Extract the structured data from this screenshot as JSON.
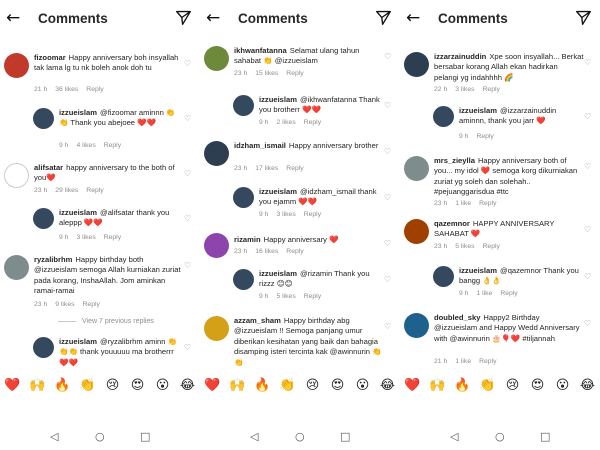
{
  "header": {
    "title": "Comments",
    "back_icon": "←"
  },
  "colors": {
    "heart": "#ed2939",
    "link": "#00376b",
    "meta": "#8e8e8e",
    "watermark": "#d38ccc"
  },
  "panels": [
    {
      "comments": [
        {
          "user": "fizoomar",
          "text": "Happy anniversary boh insyallah tak lama lg tu nk boleh anok doh tu",
          "time": "21 h",
          "likes": "36 likes",
          "reply": "Reply"
        },
        {
          "user": "izzueislam",
          "text": "@fizoomar aminnn 👏👏 Thank you abejoee ❤️❤️",
          "time": "9 h",
          "likes": "4 likes",
          "reply": "Reply"
        },
        {
          "user": "alifsatar",
          "text": "happy anniversary to the both of you❤️",
          "time": "23 h",
          "likes": "29 likes",
          "reply": "Reply"
        },
        {
          "user": "izzueislam",
          "text": "@alifsatar thank you aleppp ❤️❤️",
          "time": "9 h",
          "likes": "3 likes",
          "reply": "Reply"
        },
        {
          "user": "ryzalibrhm",
          "text": "Happy birthday both @izzueislam semoga Allah kurniakan zuriat pada korang, InshaAllah. Jom aminkan ramai-ramai",
          "time": "23 h",
          "likes": "9 likes",
          "reply": "Reply"
        },
        {
          "user": "izzueislam",
          "text": "@ryzalibrhm aminn 👏👏👏 thank youuuuu ma brotherrr ❤️❤️",
          "time": "",
          "likes": "",
          "reply": ""
        }
      ],
      "view_more": "View 7 previous replies"
    },
    {
      "comments": [
        {
          "user": "ikhwanfatanna",
          "text": "Selamat ulang tahun sahabat 👏 @izzueislam",
          "time": "23 h",
          "likes": "15 likes",
          "reply": "Reply"
        },
        {
          "user": "izzueislam",
          "text": "@ikhwanfatanna Thank you brotherr ❤️❤️",
          "time": "9 h",
          "likes": "2 likes",
          "reply": "Reply"
        },
        {
          "user": "idzham_ismail",
          "text": "Happy anniversary brother",
          "time": "23 h",
          "likes": "17 likes",
          "reply": "Reply"
        },
        {
          "user": "izzueislam",
          "text": "@idzham_ismail thank you ejamm ❤️❤️",
          "time": "9 h",
          "likes": "3 likes",
          "reply": "Reply"
        },
        {
          "user": "rizamin",
          "text": "Happy anniversary ❤️",
          "time": "23 h",
          "likes": "16 likes",
          "reply": "Reply"
        },
        {
          "user": "izzueislam",
          "text": "@rizamin Thank you rizzz 😊😊",
          "time": "9 h",
          "likes": "5 likes",
          "reply": "Reply"
        },
        {
          "user": "azzam_sham",
          "text": "Happy birthday abg @izzueislam !! Semoga panjang umur diberikan kesihatan yang baik dan bahagia disamping isteri tercinta kak @awinnurin 👏👏",
          "time": "",
          "likes": "",
          "reply": ""
        }
      ]
    },
    {
      "comments": [
        {
          "user": "izzarzainuddin",
          "text": "Xpe soon insyallah... Berkat bersabar korang Allah ekan hadirkan pelangi yg indahhhh 🌈",
          "time": "22 h",
          "likes": "3 likes",
          "reply": "Reply"
        },
        {
          "user": "izzueislam",
          "text": "@izzarzainuddin aminnn, thank you jarr ❤️",
          "time": "9 h",
          "likes": "",
          "reply": "Reply"
        },
        {
          "user": "mrs_zieylla",
          "text": "Happy anniversary both of you... my idol ❤️ semoga korg dikurniakan zuriat yg soleh dan solehah.. #pejuanggarisdua #ttc",
          "time": "23 h",
          "likes": "1 like",
          "reply": "Reply"
        },
        {
          "user": "qazemnor",
          "text": "HAPPY ANNIVERSARY SAHABAT ❤️",
          "time": "23 h",
          "likes": "5 likes",
          "reply": "Reply"
        },
        {
          "user": "izzueislam",
          "text": "@qazemnor Thank you bangg 👌👌",
          "time": "9 h",
          "likes": "1 like",
          "reply": "Reply"
        },
        {
          "user": "doubled_sky",
          "text": "Happy2 Birthday @izzueislam and Happy Wedd Anniversary with @awinnurin 🎂🎈❤️ #tiljannah",
          "time": "21 h",
          "likes": "1 like",
          "reply": "Reply"
        }
      ]
    }
  ],
  "emoji_bar": [
    "❤️",
    "🙌",
    "🔥",
    "👏",
    "😢",
    "😍",
    "😮",
    "😂",
    "❤️",
    "🙌",
    "🔥",
    "👏",
    "😢",
    "😍",
    "😮",
    "😂",
    "❤️",
    "🙌",
    "🔥",
    "👏",
    "😢",
    "😍",
    "😮",
    "😂"
  ],
  "watermark": "mural",
  "nav": {
    "back": "◁",
    "home": "○",
    "recent": "□"
  }
}
